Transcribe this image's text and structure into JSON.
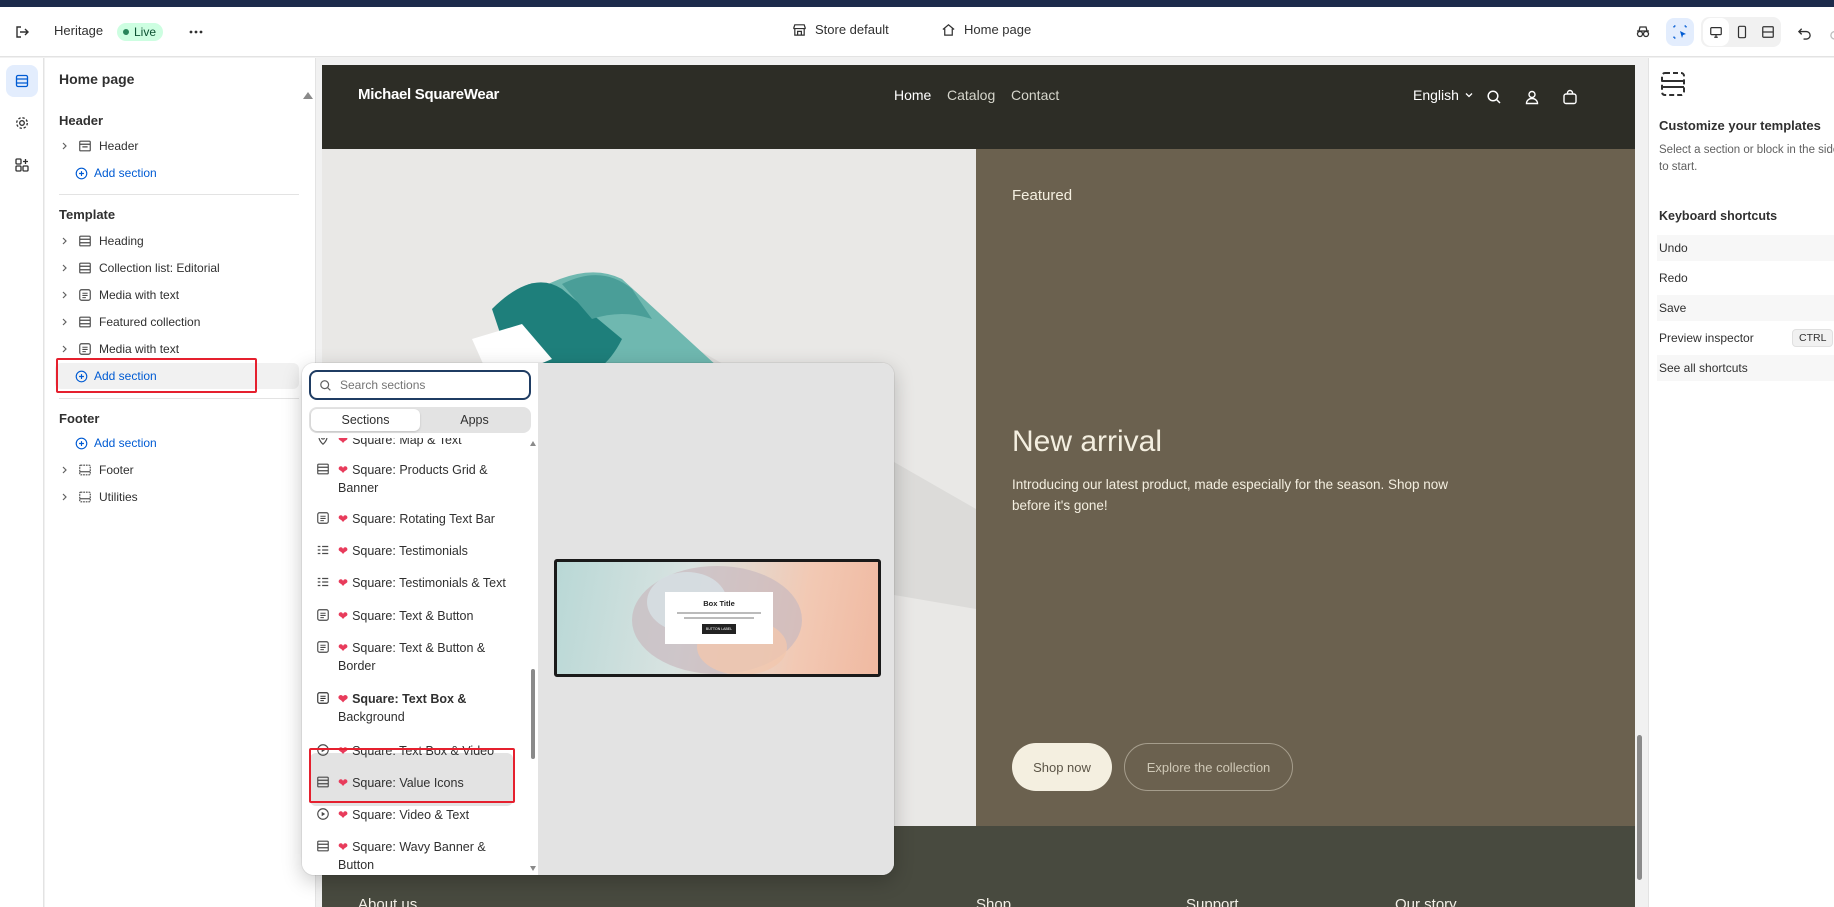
{
  "topbar": {
    "theme_name": "Heritage",
    "live_badge": "Live",
    "store_context": "Store default",
    "page_context": "Home page"
  },
  "left_panel": {
    "title": "Home page",
    "header_section": {
      "heading": "Header",
      "items": [
        {
          "label": "Header"
        }
      ],
      "add_label": "Add section"
    },
    "template_section": {
      "heading": "Template",
      "items": [
        {
          "label": "Heading"
        },
        {
          "label": "Collection list: Editorial"
        },
        {
          "label": "Media with text"
        },
        {
          "label": "Featured collection"
        },
        {
          "label": "Media with text"
        }
      ],
      "add_label": "Add section"
    },
    "footer_section": {
      "heading": "Footer",
      "add_label": "Add section",
      "items": [
        {
          "label": "Footer"
        },
        {
          "label": "Utilities"
        }
      ]
    }
  },
  "picker": {
    "search_placeholder": "Search sections",
    "tabs": [
      "Sections",
      "Apps"
    ],
    "items": [
      {
        "icon": "map-pin-icon",
        "line1": "Square: Map & Text",
        "line2": ""
      },
      {
        "icon": "layout-icon",
        "line1": "Square: Products Grid &",
        "line2": "Banner"
      },
      {
        "icon": "text-block-icon",
        "line1": "Square: Rotating Text Bar",
        "line2": ""
      },
      {
        "icon": "list-icon",
        "line1": "Square: Testimonials",
        "line2": ""
      },
      {
        "icon": "list-icon",
        "line1": "Square: Testimonials & Text",
        "line2": ""
      },
      {
        "icon": "text-block-icon",
        "line1": "Square: Text & Button",
        "line2": ""
      },
      {
        "icon": "text-block-icon",
        "line1": "Square: Text & Button &",
        "line2": "Border"
      },
      {
        "icon": "text-block-icon",
        "line1": "Square: Text Box &",
        "line2": "Background"
      },
      {
        "icon": "play-icon",
        "line1": "Square: Text Box & Video",
        "line2": ""
      },
      {
        "icon": "layout-icon",
        "line1": "Square: Value Icons",
        "line2": ""
      },
      {
        "icon": "play-icon",
        "line1": "Square: Video & Text",
        "line2": ""
      },
      {
        "icon": "layout-icon",
        "line1": "Square: Wavy Banner &",
        "line2": "Button"
      }
    ],
    "selected_index": 7,
    "preview": {
      "box_title": "Box Title",
      "box_button": "BUTTON LABEL"
    }
  },
  "store": {
    "brand": "Michael SquareWear",
    "nav": [
      "Home",
      "Catalog",
      "Contact"
    ],
    "language": "English",
    "hero": {
      "eyebrow": "Featured",
      "title": "New arrival",
      "body_line1": "Introducing our latest product, made especially for the season. Shop now",
      "body_line2": "before it's gone!",
      "primary_button": "Shop now",
      "secondary_button": "Explore the collection"
    },
    "footer_headings": [
      "About us",
      "Shop",
      "Support",
      "Our story"
    ]
  },
  "right_panel": {
    "title": "Customize your templates",
    "description": "Select a section or block in the sidebar to start.",
    "shortcuts_heading": "Keyboard shortcuts",
    "shortcuts": [
      {
        "label": "Undo",
        "key": ""
      },
      {
        "label": "Redo",
        "key": ""
      },
      {
        "label": "Save",
        "key": ""
      },
      {
        "label": "Preview inspector",
        "key": "CTRL"
      },
      {
        "label": "See all shortcuts",
        "key": ""
      }
    ]
  },
  "colors": {
    "accent_blue": "#005bd3",
    "highlight_red": "#e5202e",
    "hero_panel": "#6b614f",
    "store_header": "#2d2d26"
  }
}
